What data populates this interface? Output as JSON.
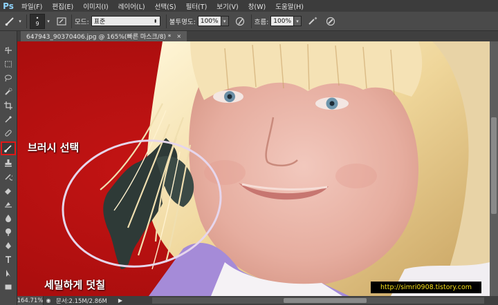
{
  "menubar": {
    "logo": "Ps",
    "items": [
      "파일(F)",
      "편집(E)",
      "이미지(I)",
      "레이어(L)",
      "선택(S)",
      "필터(T)",
      "보기(V)",
      "창(W)",
      "도움말(H)"
    ]
  },
  "options": {
    "brush_size": "9",
    "mode_label": "모드:",
    "mode_value": "표준",
    "opacity_label": "불투명도:",
    "opacity_value": "100%",
    "flow_label": "흐름:",
    "flow_value": "100%"
  },
  "document": {
    "tab_title": "647943_90370406.jpg @ 165%(빠른 마스크/8) *"
  },
  "annotations": {
    "brush_select": "브러시 선택",
    "paint_detail": "세밀하게 덧칠",
    "watermark": "http://simri0908.tistory.com"
  },
  "status": {
    "zoom": "164.71%",
    "doc_size": "문서:2.15M/2.86M"
  },
  "colors": {
    "quick_mask_red": "#b01010",
    "highlight_red": "#e01818",
    "circle_stroke": "#e6d6ec",
    "watermark_text": "#f7e11a"
  },
  "icons": {
    "tools": [
      "move-icon",
      "marquee-icon",
      "lasso-icon",
      "quick-select-icon",
      "crop-icon",
      "eyedropper-icon",
      "healing-icon",
      "brush-icon",
      "stamp-icon",
      "history-brush-icon",
      "eraser-icon",
      "gradient-icon",
      "blur-icon",
      "dodge-icon",
      "pen-icon",
      "type-icon",
      "path-select-icon",
      "shape-icon"
    ]
  }
}
